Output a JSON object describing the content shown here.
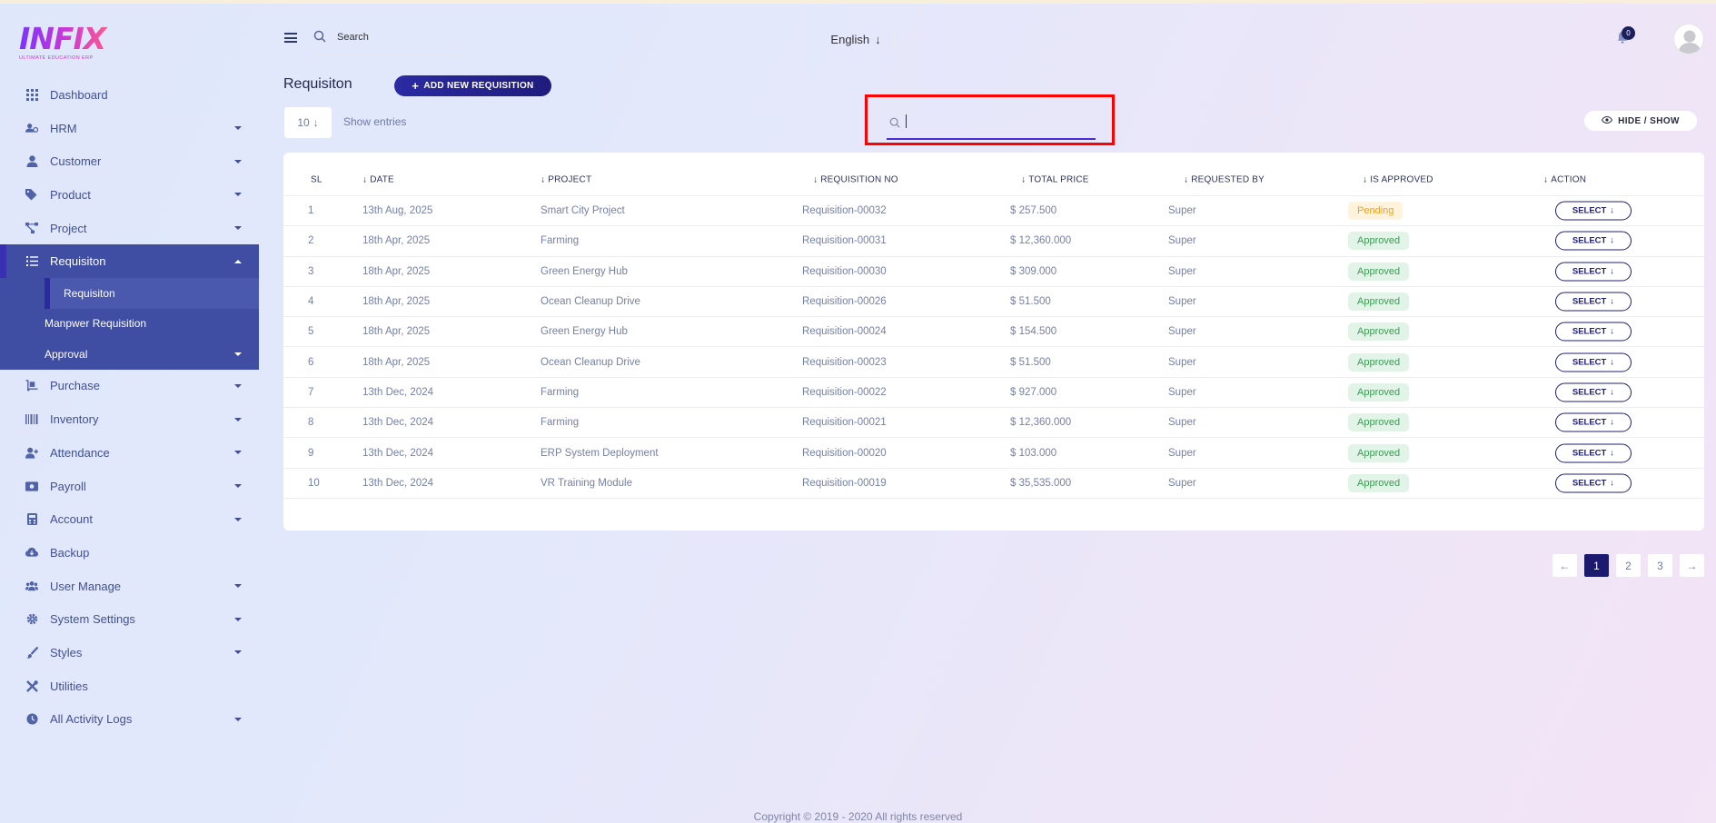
{
  "brand": {
    "logo_text": "INFIX",
    "tagline": "ULTIMATE EDUCATION ERP"
  },
  "header": {
    "search_placeholder": "Search",
    "language": "English",
    "notification_count": "0"
  },
  "sidebar": {
    "items": [
      {
        "label": "Dashboard",
        "icon": "grid-icon",
        "has_caret": false
      },
      {
        "label": "HRM",
        "icon": "users-cog-icon",
        "has_caret": true
      },
      {
        "label": "Customer",
        "icon": "user-icon",
        "has_caret": true
      },
      {
        "label": "Product",
        "icon": "tags-icon",
        "has_caret": true
      },
      {
        "label": "Project",
        "icon": "project-diagram-icon",
        "has_caret": true
      },
      {
        "label": "Requisiton",
        "icon": "list-icon",
        "has_caret": true,
        "active": true
      },
      {
        "label": "Purchase",
        "icon": "dolly-icon",
        "has_caret": true
      },
      {
        "label": "Inventory",
        "icon": "barcode-icon",
        "has_caret": true
      },
      {
        "label": "Attendance",
        "icon": "user-plus-icon",
        "has_caret": true
      },
      {
        "label": "Payroll",
        "icon": "money-icon",
        "has_caret": true
      },
      {
        "label": "Account",
        "icon": "calculator-icon",
        "has_caret": true
      },
      {
        "label": "Backup",
        "icon": "cloud-download-icon",
        "has_caret": false
      },
      {
        "label": "User Manage",
        "icon": "users-icon",
        "has_caret": true
      },
      {
        "label": "System Settings",
        "icon": "gear-icon",
        "has_caret": true
      },
      {
        "label": "Styles",
        "icon": "brush-icon",
        "has_caret": true
      },
      {
        "label": "Utilities",
        "icon": "tools-icon",
        "has_caret": false
      },
      {
        "label": "All Activity Logs",
        "icon": "clock-icon",
        "has_caret": true
      }
    ],
    "sub_items": [
      {
        "label": "Requisiton",
        "current": true
      },
      {
        "label": "Manpwer Requisition"
      },
      {
        "label": "Approval",
        "has_caret": true
      }
    ]
  },
  "page": {
    "title": "Requisiton",
    "add_button": "ADD NEW REQUISITION",
    "entries_value": "10",
    "entries_label": "Show entries",
    "table_search_value": "",
    "hide_show_label": "HIDE / SHOW"
  },
  "table": {
    "columns": [
      "SL",
      "DATE",
      "PROJECT",
      "REQUISITION NO",
      "TOTAL PRICE",
      "REQUESTED BY",
      "IS APPROVED",
      "ACTION"
    ],
    "action_label": "SELECT",
    "rows": [
      {
        "sl": "1",
        "date": "13th Aug, 2025",
        "project": "Smart City Project",
        "req_no": "Requisition-00032",
        "price": "$ 257.500",
        "by": "Super",
        "status": "Pending"
      },
      {
        "sl": "2",
        "date": "18th Apr, 2025",
        "project": "Farming",
        "req_no": "Requisition-00031",
        "price": "$ 12,360.000",
        "by": "Super",
        "status": "Approved"
      },
      {
        "sl": "3",
        "date": "18th Apr, 2025",
        "project": "Green Energy Hub",
        "req_no": "Requisition-00030",
        "price": "$ 309.000",
        "by": "Super",
        "status": "Approved"
      },
      {
        "sl": "4",
        "date": "18th Apr, 2025",
        "project": "Ocean Cleanup Drive",
        "req_no": "Requisition-00026",
        "price": "$ 51.500",
        "by": "Super",
        "status": "Approved"
      },
      {
        "sl": "5",
        "date": "18th Apr, 2025",
        "project": "Green Energy Hub",
        "req_no": "Requisition-00024",
        "price": "$ 154.500",
        "by": "Super",
        "status": "Approved"
      },
      {
        "sl": "6",
        "date": "18th Apr, 2025",
        "project": "Ocean Cleanup Drive",
        "req_no": "Requisition-00023",
        "price": "$ 51.500",
        "by": "Super",
        "status": "Approved"
      },
      {
        "sl": "7",
        "date": "13th Dec, 2024",
        "project": "Farming",
        "req_no": "Requisition-00022",
        "price": "$ 927.000",
        "by": "Super",
        "status": "Approved"
      },
      {
        "sl": "8",
        "date": "13th Dec, 2024",
        "project": "Farming",
        "req_no": "Requisition-00021",
        "price": "$ 12,360.000",
        "by": "Super",
        "status": "Approved"
      },
      {
        "sl": "9",
        "date": "13th Dec, 2024",
        "project": "ERP System Deployment",
        "req_no": "Requisition-00020",
        "price": "$ 103.000",
        "by": "Super",
        "status": "Approved"
      },
      {
        "sl": "10",
        "date": "13th Dec, 2024",
        "project": "VR Training Module",
        "req_no": "Requisition-00019",
        "price": "$ 35,535.000",
        "by": "Super",
        "status": "Approved"
      }
    ]
  },
  "pagination": {
    "pages": [
      "1",
      "2",
      "3"
    ],
    "current": "1",
    "prev_icon": "arrow-left-icon",
    "next_icon": "arrow-right-icon"
  },
  "footer": {
    "copyright": "Copyright © 2019 - 2020 All rights reserved"
  },
  "colors": {
    "accent": "#3f4da3",
    "primary_button": "#1f1c7d",
    "highlight_box": "#ff0000",
    "approved": "#3d9a55",
    "pending": "#f2a022"
  }
}
